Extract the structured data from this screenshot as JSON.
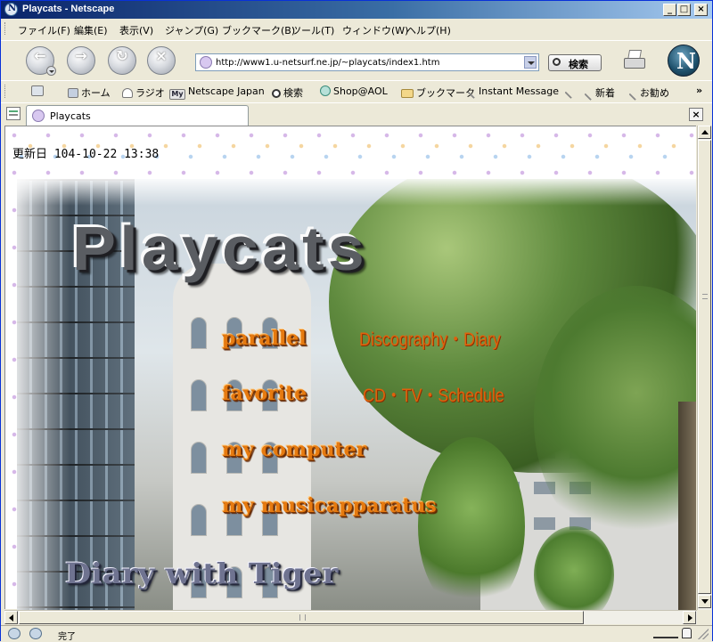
{
  "window": {
    "title": "Playcats - Netscape",
    "controls": {
      "minimize": "_",
      "maximize": "□",
      "close": "×"
    }
  },
  "menu": [
    "ファイル(F)",
    "編集(E)",
    "表示(V)",
    "ジャンプ(G)",
    "ブックマーク(B)",
    "ツール(T)",
    "ウィンドウ(W)",
    "ヘルプ(H)"
  ],
  "nav": {
    "back_glyph": "←",
    "forward_glyph": "→",
    "reload_glyph": "↻",
    "stop_glyph": "×",
    "url": "http://www1.u-netsurf.ne.jp/~playcats/index1.htm",
    "search_label": "検索"
  },
  "personal_toolbar": {
    "home": "ホーム",
    "radio": "ラジオ",
    "my_badge": "My",
    "netscape_japan": "Netscape Japan",
    "search": "検索",
    "shop_aol": "Shop@AOL",
    "bookmarks": "ブックマーク",
    "instant_message": "Instant Message",
    "new": "新着",
    "recommend": "お勧め",
    "more": "»"
  },
  "tabs": [
    {
      "label": "Playcats"
    }
  ],
  "tab_close": "×",
  "page": {
    "updated": "更新日 104-10-22  13:38",
    "site_title": "Playcats",
    "links": [
      {
        "label": "parallel",
        "desc": "Discography・Diary"
      },
      {
        "label": "favorite",
        "desc": "CD・TV・Schedule"
      },
      {
        "label": "my computer",
        "desc": ""
      },
      {
        "label": "my musicapparatus",
        "desc": ""
      }
    ],
    "diary_link": "Diary with Tiger"
  },
  "status": {
    "text": "完了"
  },
  "colors": {
    "titlebar_start": "#0a246a",
    "link_orange": "#e67a10",
    "desc_orange": "#e0610c"
  }
}
